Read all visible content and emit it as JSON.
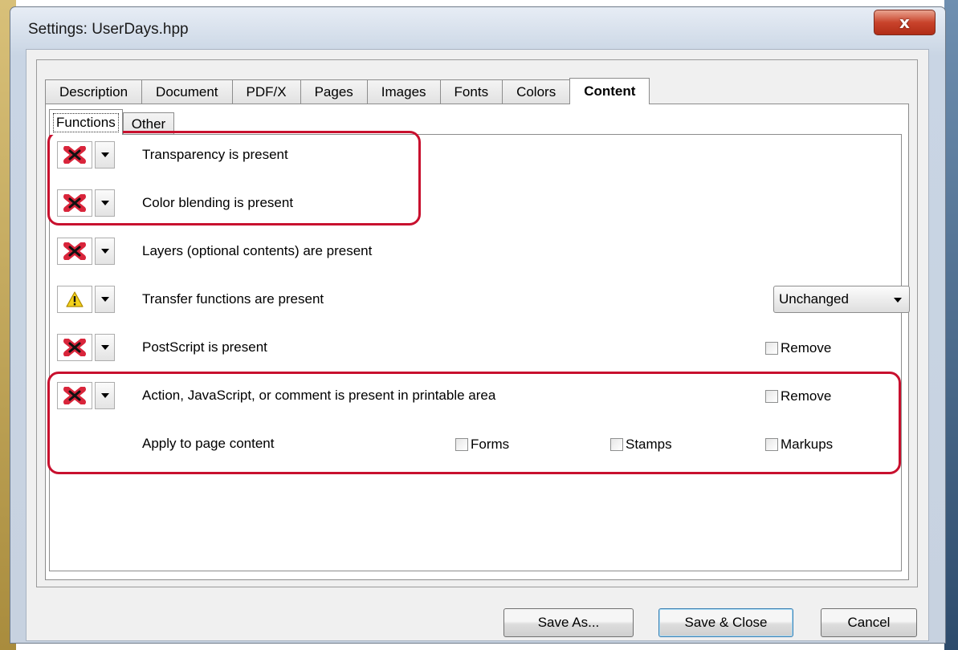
{
  "window": {
    "title": "Settings:  UserDays.hpp",
    "close_glyph": "x"
  },
  "main_tabs": [
    {
      "label": "Description"
    },
    {
      "label": "Document"
    },
    {
      "label": "PDF/X"
    },
    {
      "label": "Pages"
    },
    {
      "label": "Images"
    },
    {
      "label": "Fonts"
    },
    {
      "label": "Colors"
    },
    {
      "label": "Content",
      "active": true
    }
  ],
  "sub_tabs": [
    {
      "label": "Functions",
      "active": true
    },
    {
      "label": "Other"
    }
  ],
  "rows": [
    {
      "label": "Transparency is present",
      "status_icon": "error-x-icon"
    },
    {
      "label": "Color blending is present",
      "status_icon": "error-x-icon"
    },
    {
      "label": "Layers (optional contents) are present",
      "status_icon": "error-x-icon"
    },
    {
      "label": "Transfer functions are present",
      "status_icon": "warning-icon",
      "select_value": "Unchanged"
    },
    {
      "label": "PostScript is present",
      "status_icon": "error-x-icon",
      "checkbox_label": "Remove",
      "checked": false
    },
    {
      "label": "Action, JavaScript, or comment is present in printable area",
      "status_icon": "error-x-icon",
      "checkbox_label": "Remove",
      "checked": false
    }
  ],
  "apply": {
    "label": "Apply to page content",
    "forms": "Forms",
    "stamps": "Stamps",
    "markups": "Markups"
  },
  "buttons": {
    "save_as": "Save As...",
    "save_close": "Save & Close",
    "cancel": "Cancel"
  },
  "colors": {
    "highlight": "#c8102e",
    "error": "#d9253b",
    "warning": "#f3d21c"
  }
}
